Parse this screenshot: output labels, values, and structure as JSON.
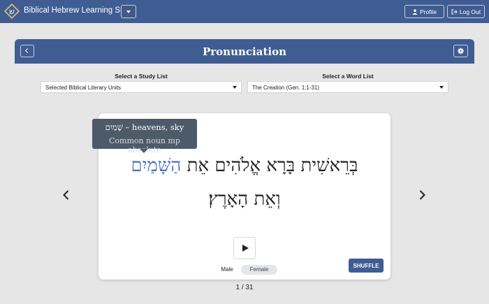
{
  "app": {
    "title": "Biblical Hebrew Learning Suite",
    "logo_letter": "ש"
  },
  "topbar": {
    "profile_label": "Profile",
    "logout_label": "Log Out"
  },
  "header": {
    "title": "Pronunciation"
  },
  "selectors": {
    "study_list_label": "Select a Study List",
    "study_list_value": "Selected Biblical Literary Units",
    "word_list_label": "Select a Word List",
    "word_list_value": "The Creation (Gen. 1:1-31)"
  },
  "card": {
    "verse_line1_main": "בְּרֵאשִׁית בָּרָא אֱלֹהִים אֵת",
    "verse_line1_highlight": "הַשָּׁמַיִם",
    "verse_line2": "וְאֵת הָאָרֶץ׃",
    "tooltip_word": "שָׁמַיִם",
    "tooltip_gloss": " – heavens, sky",
    "tooltip_parse": "Common noun mp absolute",
    "voice_male": "Male",
    "voice_female": "Female",
    "voice_selected": "Female",
    "shuffle_label": "SHUFFLE"
  },
  "pager": {
    "text": "1 / 31"
  },
  "colors": {
    "primary": "#3f5d93",
    "highlight": "#4a6fbf",
    "background": "#e6e6e6"
  }
}
